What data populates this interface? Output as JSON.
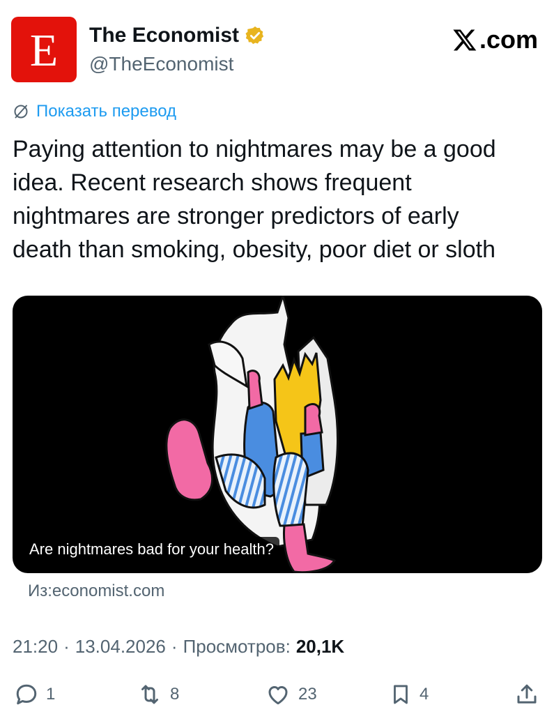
{
  "author": {
    "logo_letter": "E",
    "display_name": "The Economist",
    "handle": "@TheEconomist",
    "logo_color": "#e3120b",
    "verified_color": "#e8b41e"
  },
  "brand": {
    "text": ".com",
    "icon": "x-logo-icon"
  },
  "translate": {
    "label": "Показать перевод",
    "icon": "translate-icon",
    "color": "#1d9bf0"
  },
  "tweet": {
    "lines": [
      "Paying attention to nightmares may be a good",
      "idea. Recent research shows frequent",
      "nightmares are stronger predictors of early",
      "death than smoking, obesity, poor diet or sloth"
    ]
  },
  "card": {
    "caption": "Are nightmares bad for your health?",
    "source": "Из:economist.com"
  },
  "meta": {
    "time": "21:20",
    "date": "13.04.2026",
    "views_label": "Просмотров:",
    "views_count": "20,1K"
  },
  "actions": {
    "replies": "1",
    "reposts": "8",
    "likes": "23",
    "bookmarks": "4"
  }
}
